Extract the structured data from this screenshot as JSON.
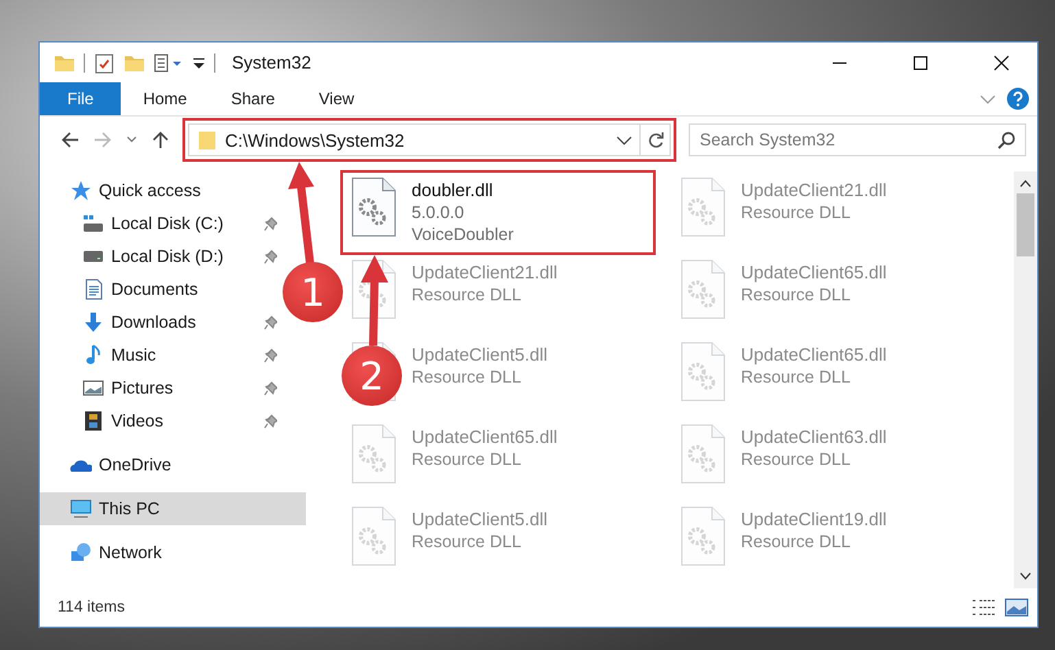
{
  "window": {
    "title": "System32"
  },
  "ribbon_tabs": [
    {
      "label": "File",
      "kind": "file",
      "selected": false
    },
    {
      "label": "Home",
      "kind": "tab",
      "selected": false
    },
    {
      "label": "Share",
      "kind": "tab",
      "selected": false
    },
    {
      "label": "View",
      "kind": "tab",
      "selected": false
    }
  ],
  "address": {
    "path": "C:\\Windows\\System32"
  },
  "search": {
    "placeholder": "Search System32"
  },
  "nav": [
    {
      "label": "Quick access",
      "kind": "star",
      "pinned": false,
      "selected": false,
      "children": [
        {
          "label": "Local Disk (C:)",
          "kind": "drive-c",
          "pinned": true,
          "selected": false
        },
        {
          "label": "Local Disk (D:)",
          "kind": "drive",
          "pinned": true,
          "selected": false
        },
        {
          "label": "Documents",
          "kind": "docs",
          "pinned": false,
          "selected": false
        },
        {
          "label": "Downloads",
          "kind": "download",
          "pinned": true,
          "selected": false
        },
        {
          "label": "Music",
          "kind": "music",
          "pinned": true,
          "selected": false
        },
        {
          "label": "Pictures",
          "kind": "pictures",
          "pinned": true,
          "selected": false
        },
        {
          "label": "Videos",
          "kind": "videos",
          "pinned": true,
          "selected": false
        }
      ]
    },
    {
      "label": "OneDrive",
      "kind": "cloud",
      "pinned": false,
      "selected": false
    },
    {
      "label": "This PC",
      "kind": "pc",
      "pinned": false,
      "selected": true
    },
    {
      "label": "Network",
      "kind": "network",
      "pinned": false,
      "selected": false
    }
  ],
  "files": [
    {
      "name": "doubler.dll",
      "details": [
        "5.0.0.0",
        "VoiceDoubler"
      ],
      "dimmed": false
    },
    {
      "name": "UpdateClient21.dll",
      "details": [
        "Resource DLL"
      ],
      "dimmed": true
    },
    {
      "name": "UpdateClient21.dll",
      "details": [
        "Resource DLL"
      ],
      "dimmed": true
    },
    {
      "name": "UpdateClient65.dll",
      "details": [
        "Resource DLL"
      ],
      "dimmed": true
    },
    {
      "name": "UpdateClient5.dll",
      "details": [
        "Resource DLL"
      ],
      "dimmed": true
    },
    {
      "name": "UpdateClient65.dll",
      "details": [
        "Resource DLL"
      ],
      "dimmed": true
    },
    {
      "name": "UpdateClient65.dll",
      "details": [
        "Resource DLL"
      ],
      "dimmed": true
    },
    {
      "name": "UpdateClient63.dll",
      "details": [
        "Resource DLL"
      ],
      "dimmed": true
    },
    {
      "name": "UpdateClient5.dll",
      "details": [
        "Resource DLL"
      ],
      "dimmed": true
    },
    {
      "name": "UpdateClient19.dll",
      "details": [
        "Resource DLL"
      ],
      "dimmed": true
    }
  ],
  "status_bar": {
    "item_count": "114 items"
  },
  "annotations": [
    {
      "label": "1",
      "kind": "address"
    },
    {
      "label": "2",
      "kind": "file"
    }
  ]
}
